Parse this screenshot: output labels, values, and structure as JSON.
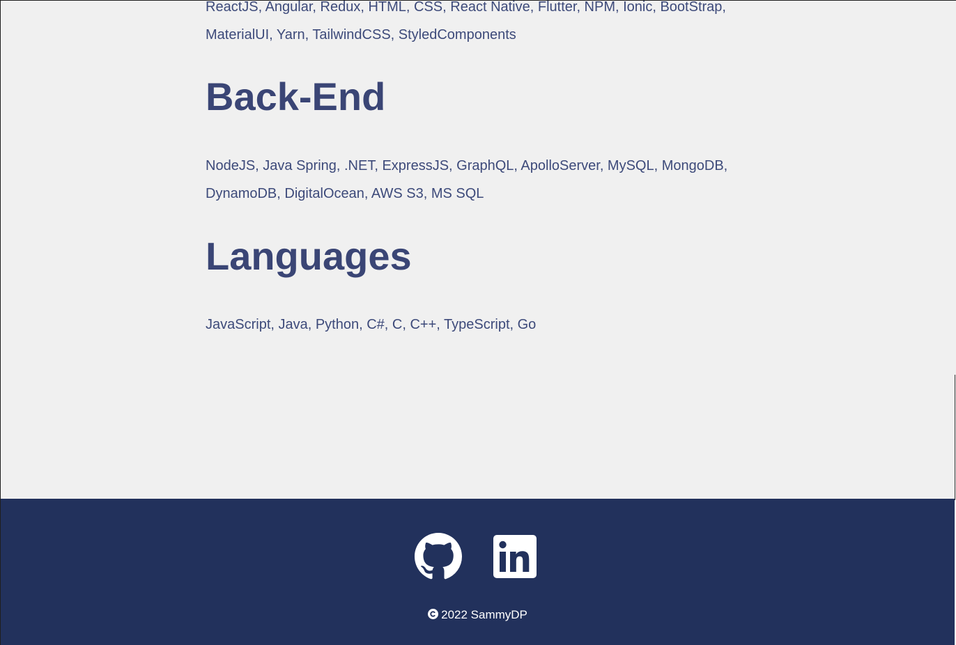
{
  "sections": {
    "frontend": {
      "skills": "ReactJS, Angular, Redux, HTML, CSS, React Native, Flutter, NPM, Ionic, BootStrap, MaterialUI, Yarn, TailwindCSS, StyledComponents"
    },
    "backend": {
      "heading": "Back-End",
      "skills": "NodeJS, Java Spring, .NET, ExpressJS, GraphQL, ApolloServer, MySQL, MongoDB, DynamoDB, DigitalOcean, AWS S3, MS SQL"
    },
    "languages": {
      "heading": "Languages",
      "skills": "JavaScript, Java, Python, C#, C, C++, TypeScript, Go"
    }
  },
  "footer": {
    "links": [
      {
        "icon": "github-icon"
      },
      {
        "icon": "linkedin-icon"
      }
    ],
    "copyright": "2022 SammyDP"
  },
  "colors": {
    "background": "#f0f0f0",
    "heading": "#3a4575",
    "body_text": "#3d4a7a",
    "footer_bg": "#22315c",
    "footer_text": "#ffffff"
  }
}
